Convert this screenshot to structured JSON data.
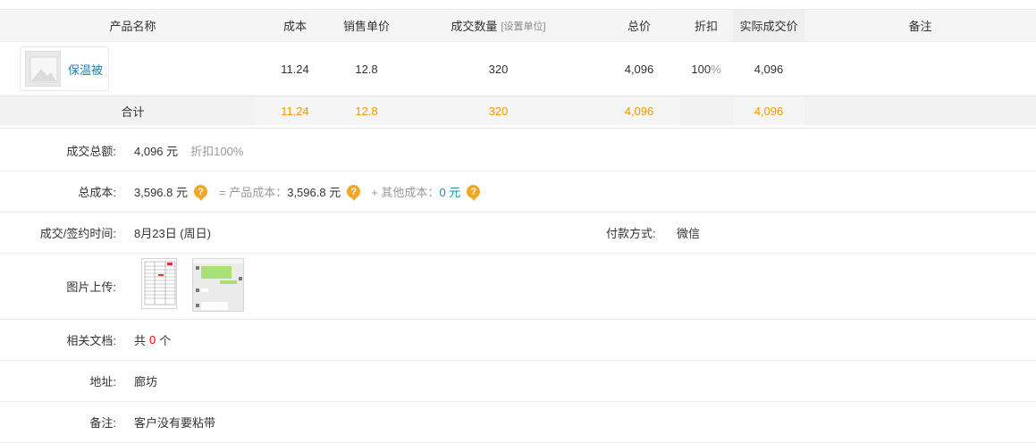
{
  "table": {
    "headers": {
      "product_name": "产品名称",
      "cost": "成本",
      "unit_price": "销售单价",
      "quantity": "成交数量",
      "quantity_hint": "[设置单位]",
      "total": "总价",
      "discount": "折扣",
      "actual_price": "实际成交价",
      "remark": "备注"
    },
    "row": {
      "product": "保温被",
      "cost": "11.24",
      "unit_price": "12.8",
      "quantity": "320",
      "total": "4,096",
      "discount": "100",
      "discount_unit": "%",
      "actual_price": "4,096",
      "remark": ""
    },
    "totals": {
      "label": "合计",
      "cost": "11.24",
      "unit_price": "12.8",
      "quantity": "320",
      "total": "4,096",
      "actual_price": "4,096"
    }
  },
  "details": {
    "total_amount": {
      "label": "成交总额:",
      "value": "4,096 元",
      "discount": "折扣100%"
    },
    "total_cost": {
      "label": "总成本:",
      "value": "3,596.8 元",
      "product_cost_label": "= 产品成本：",
      "product_cost_value": "3,596.8 元",
      "other_cost_label": "+ 其他成本：",
      "other_cost_value": "0 元"
    },
    "deal_time": {
      "label": "成交/签约时间:",
      "value": "8月23日 (周日)"
    },
    "payment": {
      "label": "付款方式:",
      "value": "微信"
    },
    "images": {
      "label": "图片上传:"
    },
    "documents": {
      "label": "相关文档:",
      "prefix": "共",
      "count": "0",
      "suffix": "个"
    },
    "address": {
      "label": "地址:",
      "value": "廊坊"
    },
    "remark": {
      "label": "备注:",
      "value": "客户没有要粘带"
    }
  },
  "colors": {
    "accent_orange": "#f39800",
    "link_blue": "#1f7fb2",
    "help_icon": "#f5a623",
    "zero_teal": "#1a8ea0",
    "count_red": "#e00000"
  },
  "icons": {
    "help": "question-icon",
    "product_thumb": "image-placeholder-icon"
  }
}
